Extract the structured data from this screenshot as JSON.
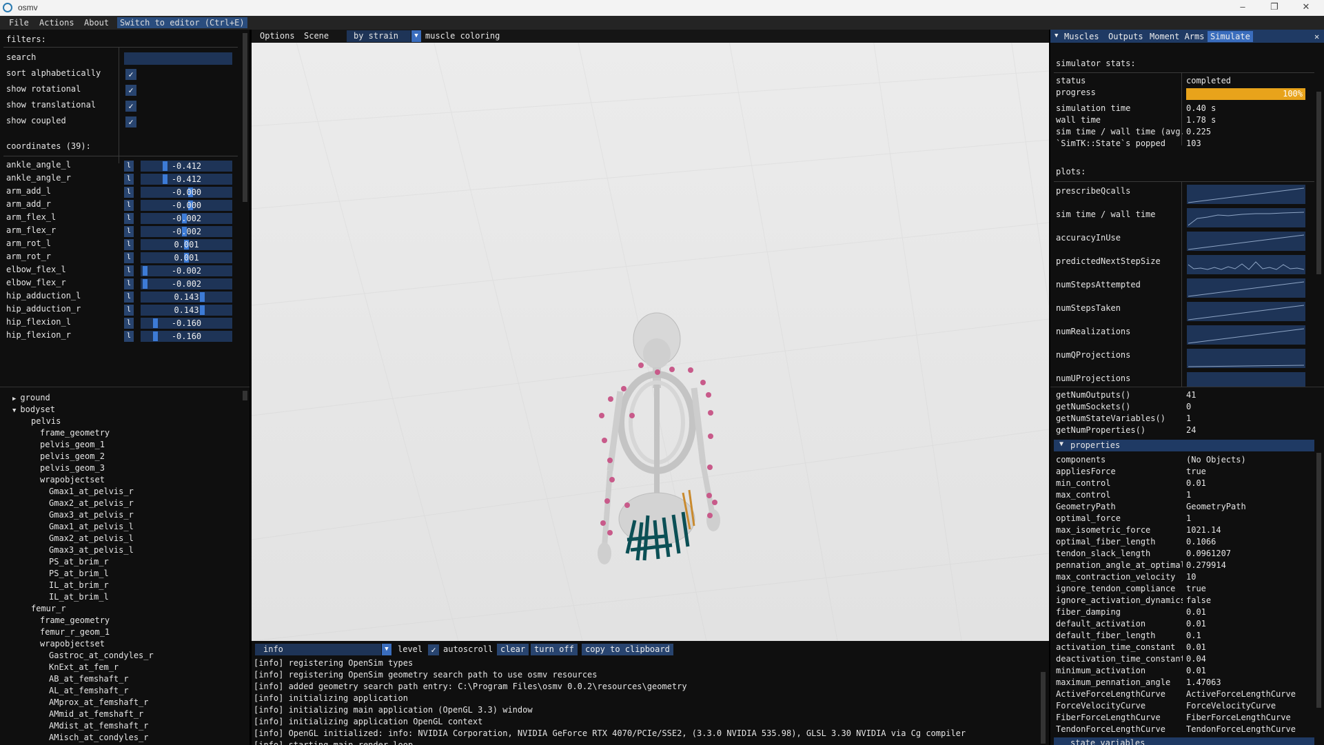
{
  "window": {
    "title": "osmv",
    "minimize": "–",
    "maximize": "❐",
    "close": "✕"
  },
  "menubar": {
    "items": [
      "File",
      "Actions",
      "About",
      "Switch to editor (Ctrl+E)"
    ]
  },
  "coords_panel": {
    "filters_label": "filters:",
    "search_label": "search",
    "search_value": "",
    "checks": [
      {
        "label": "sort alphabetically",
        "checked": true
      },
      {
        "label": "show rotational",
        "checked": true
      },
      {
        "label": "show translational",
        "checked": true
      },
      {
        "label": "show coupled",
        "checked": true
      }
    ],
    "check_glyph": "✓",
    "lock_glyph": "l",
    "coords_label": "coordinates (39):",
    "coordinates": [
      {
        "name": "ankle_angle_l",
        "value": "-0.412",
        "level": 0.25
      },
      {
        "name": "ankle_angle_r",
        "value": "-0.412",
        "level": 0.25
      },
      {
        "name": "arm_add_l",
        "value": "-0.000",
        "level": 0.55
      },
      {
        "name": "arm_add_r",
        "value": "-0.000",
        "level": 0.55
      },
      {
        "name": "arm_flex_l",
        "value": "-0.002",
        "level": 0.48
      },
      {
        "name": "arm_flex_r",
        "value": "-0.002",
        "level": 0.48
      },
      {
        "name": "arm_rot_l",
        "value": "0.001",
        "level": 0.5
      },
      {
        "name": "arm_rot_r",
        "value": "0.001",
        "level": 0.5
      },
      {
        "name": "elbow_flex_l",
        "value": "-0.002",
        "level": 0.02
      },
      {
        "name": "elbow_flex_r",
        "value": "-0.002",
        "level": 0.02
      },
      {
        "name": "hip_adduction_l",
        "value": "0.143",
        "level": 0.68
      },
      {
        "name": "hip_adduction_r",
        "value": "0.143",
        "level": 0.68
      },
      {
        "name": "hip_flexion_l",
        "value": "-0.160",
        "level": 0.14
      },
      {
        "name": "hip_flexion_r",
        "value": "-0.160",
        "level": 0.14
      }
    ]
  },
  "tree": {
    "expanded_glyph": "▼",
    "collapsed_glyph": "▶",
    "items": [
      {
        "label": "ground",
        "depth": 0,
        "arrow": "collapsed"
      },
      {
        "label": "bodyset",
        "depth": 0,
        "arrow": "expanded"
      },
      {
        "label": "pelvis",
        "depth": 1
      },
      {
        "label": "frame_geometry",
        "depth": 2
      },
      {
        "label": "pelvis_geom_1",
        "depth": 2
      },
      {
        "label": "pelvis_geom_2",
        "depth": 2
      },
      {
        "label": "pelvis_geom_3",
        "depth": 2
      },
      {
        "label": "wrapobjectset",
        "depth": 2
      },
      {
        "label": "Gmax1_at_pelvis_r",
        "depth": 3
      },
      {
        "label": "Gmax2_at_pelvis_r",
        "depth": 3
      },
      {
        "label": "Gmax3_at_pelvis_r",
        "depth": 3
      },
      {
        "label": "Gmax1_at_pelvis_l",
        "depth": 3
      },
      {
        "label": "Gmax2_at_pelvis_l",
        "depth": 3
      },
      {
        "label": "Gmax3_at_pelvis_l",
        "depth": 3
      },
      {
        "label": "PS_at_brim_r",
        "depth": 3
      },
      {
        "label": "PS_at_brim_l",
        "depth": 3
      },
      {
        "label": "IL_at_brim_r",
        "depth": 3
      },
      {
        "label": "IL_at_brim_l",
        "depth": 3
      },
      {
        "label": "femur_r",
        "depth": 1
      },
      {
        "label": "frame_geometry",
        "depth": 2
      },
      {
        "label": "femur_r_geom_1",
        "depth": 2
      },
      {
        "label": "wrapobjectset",
        "depth": 2
      },
      {
        "label": "Gastroc_at_condyles_r",
        "depth": 3
      },
      {
        "label": "KnExt_at_fem_r",
        "depth": 3
      },
      {
        "label": "AB_at_femshaft_r",
        "depth": 3
      },
      {
        "label": "AL_at_femshaft_r",
        "depth": 3
      },
      {
        "label": "AMprox_at_femshaft_r",
        "depth": 3
      },
      {
        "label": "AMmid_at_femshaft_r",
        "depth": 3
      },
      {
        "label": "AMdist_at_femshaft_r",
        "depth": 3
      },
      {
        "label": "AMisch_at_condyles_r",
        "depth": 3
      }
    ]
  },
  "viewport": {
    "options_label": "Options",
    "scene_label": "Scene",
    "coloring_value": "by strain",
    "coloring_label": "muscle coloring",
    "dropdown_glyph": "▼"
  },
  "log": {
    "level_value": "info",
    "level_label": "level",
    "autoscroll_label": "autoscroll",
    "clear_label": "clear",
    "turn_off_label": "turn off",
    "copy_label": "copy to clipboard",
    "lines": [
      "[info] registering OpenSim types",
      "[info] registering OpenSim geometry search path to use osmv resources",
      "[info] added geometry search path entry: C:\\Program Files\\osmv 0.0.2\\resources\\geometry",
      "[info] initializing application",
      "[info] initializing main application (OpenGL 3.3) window",
      "[info] initializing application OpenGL context",
      "[info] OpenGL initialized: info: NVIDIA Corporation, NVIDIA GeForce RTX 4070/PCIe/SSE2, (3.3.0 NVIDIA 535.98), GLSL 3.30 NVIDIA via Cg compiler",
      "[info] starting main render loop"
    ]
  },
  "sim_panel": {
    "tabs": [
      "Muscles",
      "Outputs",
      "Moment Arms",
      "Simulate"
    ],
    "active_tab": "Simulate",
    "tab_glyph": "▼",
    "close_glyph": "✕",
    "stats_label": "simulator stats:",
    "progress": {
      "label": "progress",
      "value": 1.0,
      "text": "100%",
      "color": "#e8a31b"
    },
    "stats": [
      {
        "label": "status",
        "value": "completed"
      },
      {
        "label": "simulation time",
        "value": "0.40 s"
      },
      {
        "label": "wall time",
        "value": "1.78 s"
      },
      {
        "label": "sim time / wall time (avg.)",
        "value": "0.225"
      },
      {
        "label": "`SimTK::State`s popped",
        "value": "103"
      }
    ],
    "plots_label": "plots:",
    "plots": [
      "prescribeQcalls",
      "sim time / wall time",
      "accuracyInUse",
      "predictedNextStepSize",
      "numStepsAttempted",
      "numStepsTaken",
      "numRealizations",
      "numQProjections",
      "numUProjections"
    ]
  },
  "props_panel": {
    "summary": [
      {
        "label": "getNumOutputs()",
        "value": "41"
      },
      {
        "label": "getNumSockets()",
        "value": "0"
      },
      {
        "label": "getNumStateVariables()",
        "value": "1"
      },
      {
        "label": "getNumProperties()",
        "value": "24"
      }
    ],
    "properties_header": "properties",
    "header_glyph": "▼",
    "properties": [
      {
        "label": "components",
        "value": "(No Objects)"
      },
      {
        "label": "appliesForce",
        "value": "true"
      },
      {
        "label": "min_control",
        "value": "0.01"
      },
      {
        "label": "max_control",
        "value": "1"
      },
      {
        "label": "GeometryPath",
        "value": "GeometryPath"
      },
      {
        "label": "optimal_force",
        "value": "1"
      },
      {
        "label": "max_isometric_force",
        "value": "1021.14"
      },
      {
        "label": "optimal_fiber_length",
        "value": "0.1066"
      },
      {
        "label": "tendon_slack_length",
        "value": "0.0961207"
      },
      {
        "label": "pennation_angle_at_optimal",
        "value": "0.279914"
      },
      {
        "label": "max_contraction_velocity",
        "value": "10"
      },
      {
        "label": "ignore_tendon_compliance",
        "value": "true"
      },
      {
        "label": "ignore_activation_dynamics",
        "value": "false"
      },
      {
        "label": "fiber_damping",
        "value": "0.01"
      },
      {
        "label": "default_activation",
        "value": "0.01"
      },
      {
        "label": "default_fiber_length",
        "value": "0.1"
      },
      {
        "label": "activation_time_constant",
        "value": "0.01"
      },
      {
        "label": "deactivation_time_constant",
        "value": "0.04"
      },
      {
        "label": "minimum_activation",
        "value": "0.01"
      },
      {
        "label": "maximum_pennation_angle",
        "value": "1.47063"
      },
      {
        "label": "ActiveForceLengthCurve",
        "value": "ActiveForceLengthCurve"
      },
      {
        "label": "ForceVelocityCurve",
        "value": "ForceVelocityCurve"
      },
      {
        "label": "FiberForceLengthCurve",
        "value": "FiberForceLengthCurve"
      },
      {
        "label": "TendonForceLengthCurve",
        "value": "TendonForceLengthCurve"
      }
    ],
    "state_variables_header": "state variables"
  }
}
